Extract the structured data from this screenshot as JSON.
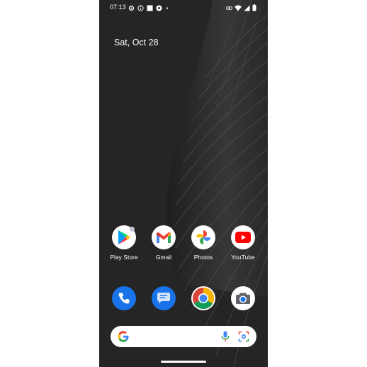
{
  "status_bar": {
    "time": "07:13",
    "left_icons": [
      "gear-icon",
      "info-circle-icon",
      "square-icon",
      "settings-badge-icon",
      "dot-icon"
    ],
    "right_icons": [
      "link-icon",
      "wifi-icon",
      "signal-icon",
      "battery-icon"
    ]
  },
  "home": {
    "date": "Sat, Oct 28"
  },
  "apps": [
    {
      "label": "Play Store",
      "icon": "play-store-icon",
      "has_badge": true
    },
    {
      "label": "Gmail",
      "icon": "gmail-icon"
    },
    {
      "label": "Photos",
      "icon": "photos-icon"
    },
    {
      "label": "YouTube",
      "icon": "youtube-icon"
    }
  ],
  "dock": [
    {
      "icon": "phone-icon",
      "color": "#1a73e8"
    },
    {
      "icon": "messages-icon",
      "color": "#1a73e8"
    },
    {
      "icon": "chrome-icon",
      "color": "#ffffff"
    },
    {
      "icon": "camera-icon",
      "color": "#ffffff"
    }
  ],
  "search_bar": {
    "icons": [
      "google-g-icon",
      "mic-icon",
      "lens-icon"
    ]
  },
  "colors": {
    "wallpaper": "#262626",
    "accent_blue": "#1a73e8"
  }
}
